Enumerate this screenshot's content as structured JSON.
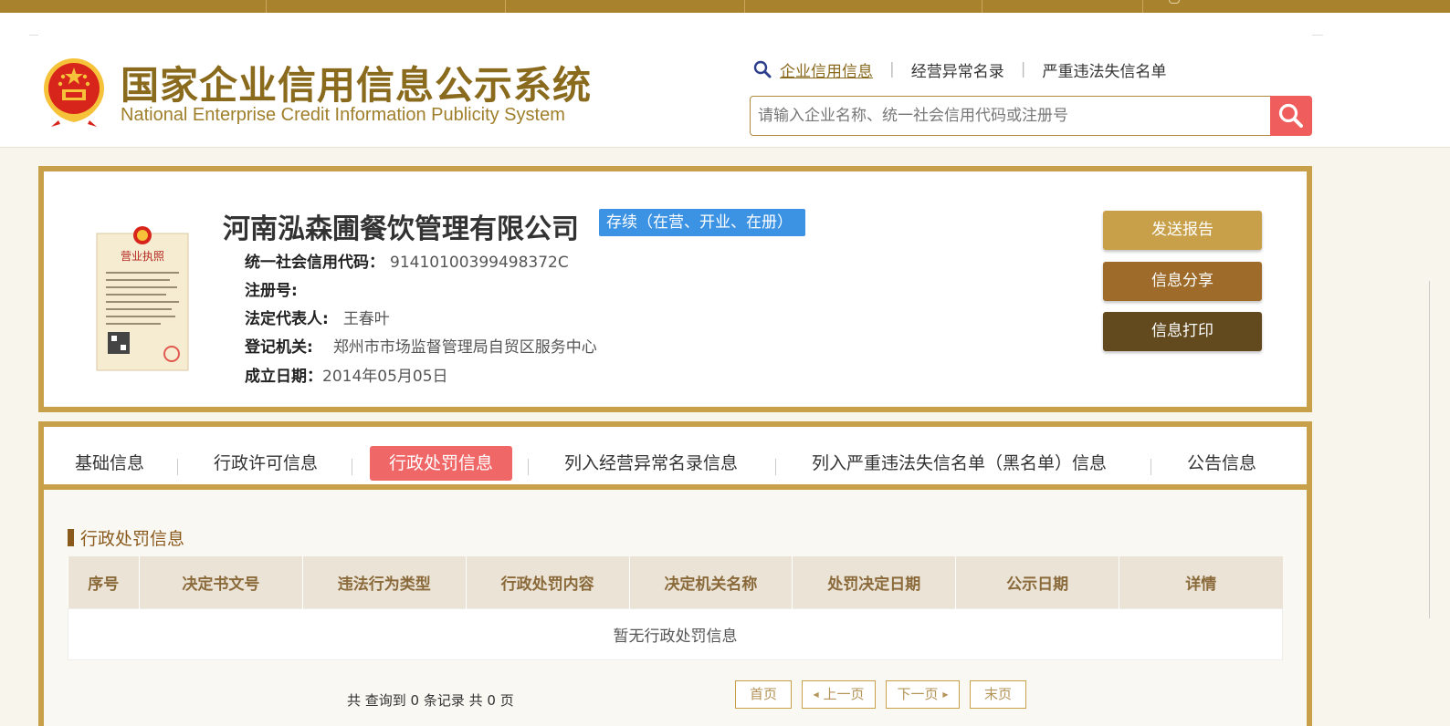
{
  "header": {
    "title_cn": "国家企业信用信息公示系统",
    "title_en": "National Enterprise Credit Information Publicity System",
    "search_tabs": [
      "企业信用信息",
      "经营异常名录",
      "严重违法失信名单"
    ],
    "search_placeholder": "请输入企业名称、统一社会信用代码或注册号"
  },
  "company": {
    "name": "河南泓森圃餐饮管理有限公司",
    "status": "存续（在营、开业、在册）",
    "credit_code_label": "统一社会信用代码：",
    "credit_code": "91410100399498372C",
    "reg_no_label": "注册号:",
    "reg_no": "",
    "legal_rep_label": "法定代表人:",
    "legal_rep": "王春叶",
    "authority_label": "登记机关:",
    "authority": "郑州市市场监督管理局自贸区服务中心",
    "founded_label": "成立日期：",
    "founded": "2014年05月05日"
  },
  "actions": {
    "send_report": "发送报告",
    "share": "信息分享",
    "print": "信息打印"
  },
  "tabs": [
    "基础信息",
    "行政许可信息",
    "行政处罚信息",
    "列入经营异常名录信息",
    "列入严重违法失信名单（黑名单）信息",
    "公告信息"
  ],
  "active_tab": "行政处罚信息",
  "section": {
    "title": "行政处罚信息",
    "columns": [
      "序号",
      "决定书文号",
      "违法行为类型",
      "行政处罚内容",
      "决定机关名称",
      "处罚决定日期",
      "公示日期",
      "详情"
    ],
    "empty_message": "暂无行政处罚信息"
  },
  "pagination": {
    "summary": "共 查询到 0 条记录 共 0 页",
    "first": "首页",
    "prev": "上一页",
    "next": "下一页",
    "last": "末页"
  },
  "colors": {
    "gold": "#c9a04a",
    "brown": "#9e6b2a",
    "dark_brown": "#634a1e",
    "active_tab": "#ef6767",
    "status_badge": "#3d93e3",
    "search_button": "#ef5d5d"
  },
  "icons": {
    "emblem": "national-emblem-icon",
    "search": "magnifier-icon",
    "license": "business-license-image"
  }
}
